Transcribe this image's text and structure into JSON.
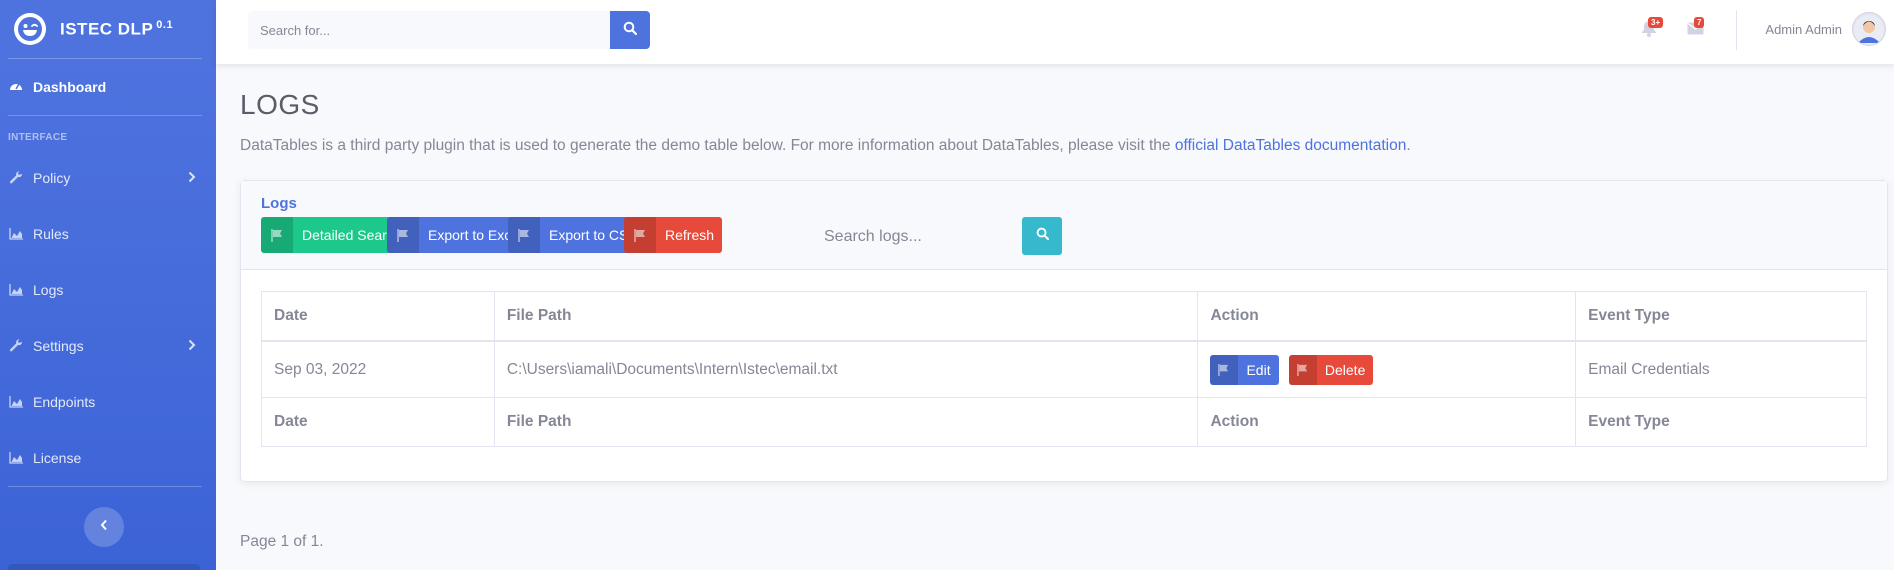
{
  "brand": {
    "name": "ISTEC DLP",
    "version": "0.1"
  },
  "sidebar": {
    "heading": "INTERFACE",
    "items": [
      {
        "label": "Dashboard",
        "icon": "tachometer-icon"
      },
      {
        "label": "Policy",
        "icon": "wrench-icon"
      },
      {
        "label": "Rules",
        "icon": "chart-area-icon"
      },
      {
        "label": "Logs",
        "icon": "chart-area-icon"
      },
      {
        "label": "Settings",
        "icon": "wrench-icon"
      },
      {
        "label": "Endpoints",
        "icon": "chart-area-icon"
      },
      {
        "label": "License",
        "icon": "chart-area-icon"
      }
    ]
  },
  "topbar": {
    "search_placeholder": "Search for...",
    "alerts_badge": "3+",
    "messages_badge": "7",
    "user_name": "Admin Admin"
  },
  "page": {
    "title": "LOGS",
    "desc_prefix": "DataTables is a third party plugin that is used to generate the demo table below. For more information about DataTables, please visit the ",
    "desc_link": "official DataTables documentation",
    "desc_suffix": "."
  },
  "card": {
    "title": "Logs",
    "buttons": {
      "detailed_search": "Detailed Search",
      "export_excel": "Export to Excel",
      "export_csv": "Export to CSV",
      "refresh": "Refresh"
    },
    "search_placeholder": "Search logs..."
  },
  "table": {
    "headers": [
      "Date",
      "File Path",
      "Action",
      "Event Type"
    ],
    "rows": [
      {
        "date": "Sep 03, 2022",
        "file_path": "C:\\Users\\iamali\\Documents\\Intern\\Istec\\email.txt",
        "edit_label": "Edit",
        "delete_label": "Delete",
        "event_type": "Email Credentials"
      }
    ],
    "footers": [
      "Date",
      "File Path",
      "Action",
      "Event Type"
    ]
  },
  "pager": "Page 1 of 1.",
  "colors": {
    "primary": "#4e73df",
    "success": "#1cc88a",
    "danger": "#e74a3b",
    "info": "#36b9cc"
  }
}
